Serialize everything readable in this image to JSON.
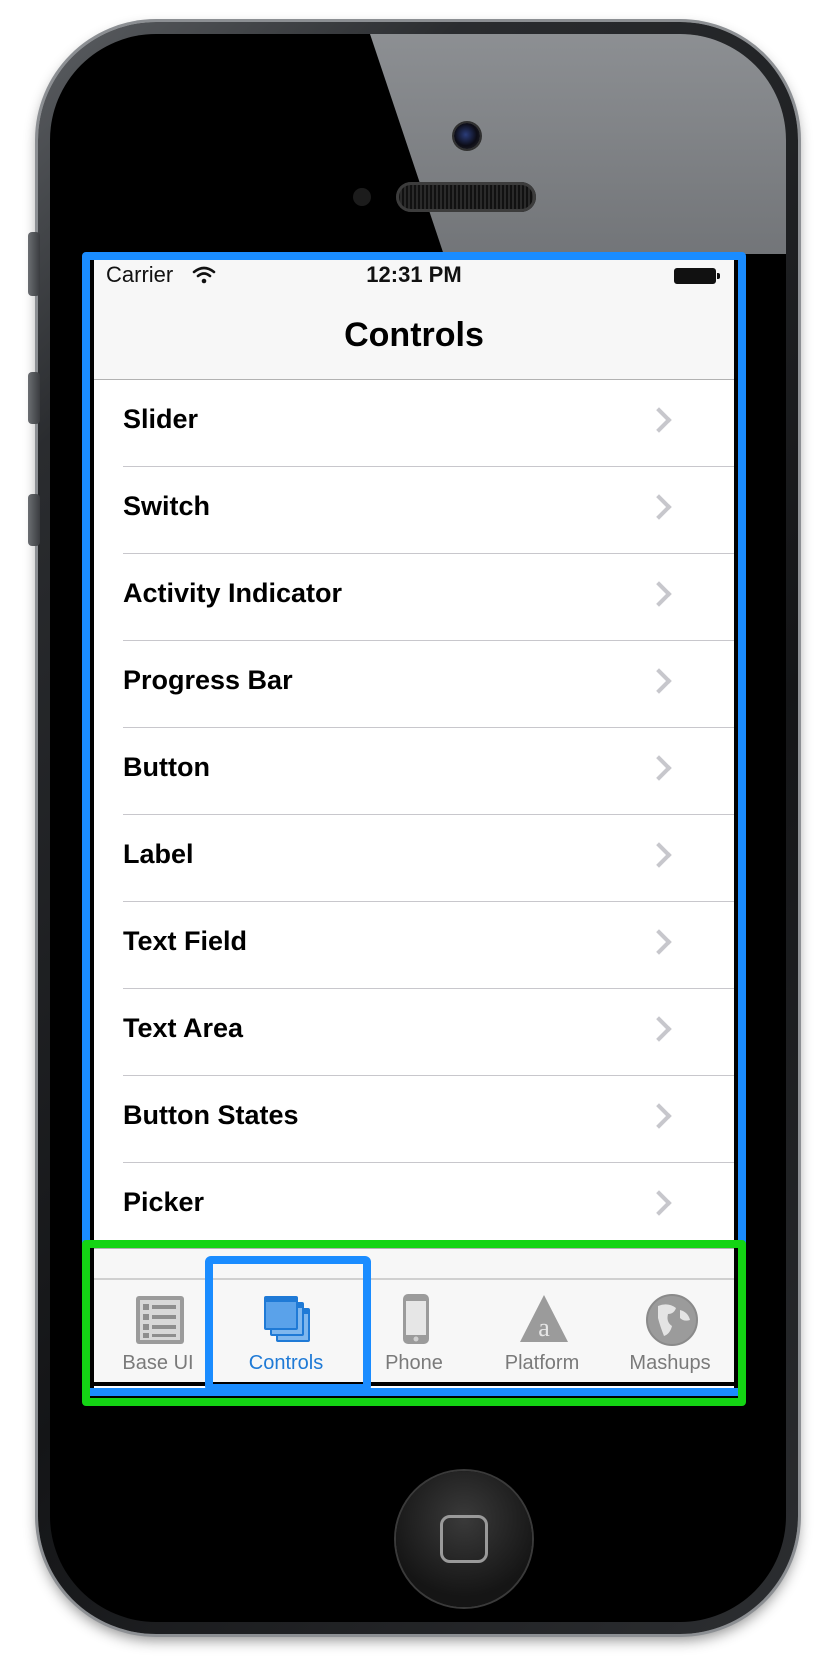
{
  "status_bar": {
    "carrier": "Carrier",
    "time": "12:31 PM"
  },
  "nav": {
    "title": "Controls"
  },
  "list": {
    "items": [
      {
        "label": "Slider"
      },
      {
        "label": "Switch"
      },
      {
        "label": "Activity Indicator"
      },
      {
        "label": "Progress Bar"
      },
      {
        "label": "Button"
      },
      {
        "label": "Label"
      },
      {
        "label": "Text Field"
      },
      {
        "label": "Text Area"
      },
      {
        "label": "Button States"
      },
      {
        "label": "Picker"
      }
    ]
  },
  "tabbar": {
    "tabs": [
      {
        "label": "Base UI",
        "icon": "list-icon"
      },
      {
        "label": "Controls",
        "icon": "windows-icon",
        "active": true
      },
      {
        "label": "Phone",
        "icon": "phone-icon"
      },
      {
        "label": "Platform",
        "icon": "platform-icon"
      },
      {
        "label": "Mashups",
        "icon": "globe-icon"
      }
    ]
  },
  "colors": {
    "accent": "#1f7ad6",
    "highlight_blue": "#1a8cff",
    "highlight_green": "#14d414",
    "inactive_icon": "#9b9b9b"
  }
}
